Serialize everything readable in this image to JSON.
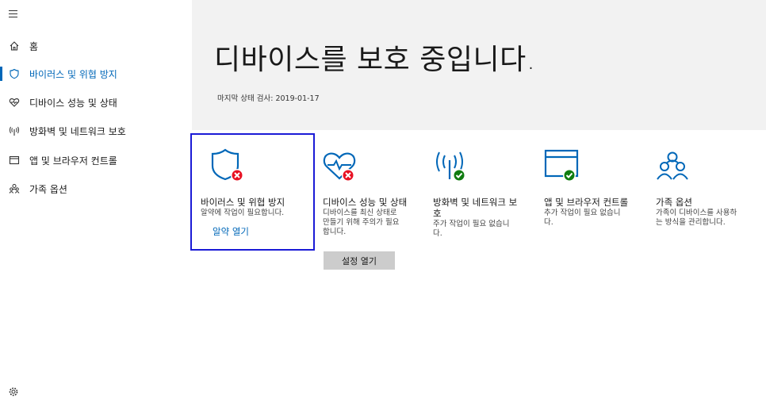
{
  "sidebar": {
    "items": [
      {
        "label": "홈",
        "icon": "home-icon"
      },
      {
        "label": "바이러스 및 위협 방지",
        "icon": "shield-icon",
        "active": true
      },
      {
        "label": "디바이스 성능 및 상태",
        "icon": "heart-icon"
      },
      {
        "label": "방화벽 및 네트워크 보호",
        "icon": "antenna-icon"
      },
      {
        "label": "앱 및 브라우저 컨트롤",
        "icon": "browser-window-icon"
      },
      {
        "label": "가족 옵션",
        "icon": "family-icon"
      }
    ]
  },
  "header": {
    "title": "디바이스를 보호 중입니다.",
    "last_scan": "마지막 상태 검사: 2019-01-17"
  },
  "tiles": [
    {
      "title": "바이러스 및 위협 방지",
      "desc": [
        "알약에 작업이 필요합니다."
      ],
      "link": "알약 열기",
      "status": "error"
    },
    {
      "title": "디바이스 성능 및 상태",
      "desc": [
        "디바이스를 최신 상태로",
        "만들기 위해 주의가 필요",
        "합니다."
      ],
      "button": "설정 열기",
      "status": "error"
    },
    {
      "title_lines": [
        "방화벽 및 네트워크 보",
        "호"
      ],
      "desc": [
        "주가 작업이 필요 없습니",
        "다."
      ],
      "status": "ok"
    },
    {
      "title": "앱 및 브라우저 컨트롤",
      "desc": [
        "추가 작업이 필요 없습니",
        "다."
      ],
      "status": "ok"
    },
    {
      "title": "가족 옵션",
      "desc": [
        "가족이 디바이스를 사용하",
        "는 방식을 관리합니다."
      ]
    }
  ],
  "colors": {
    "accent": "#0067b8",
    "error": "#e81123",
    "ok": "#107c10",
    "selection": "#1b1bd6"
  }
}
